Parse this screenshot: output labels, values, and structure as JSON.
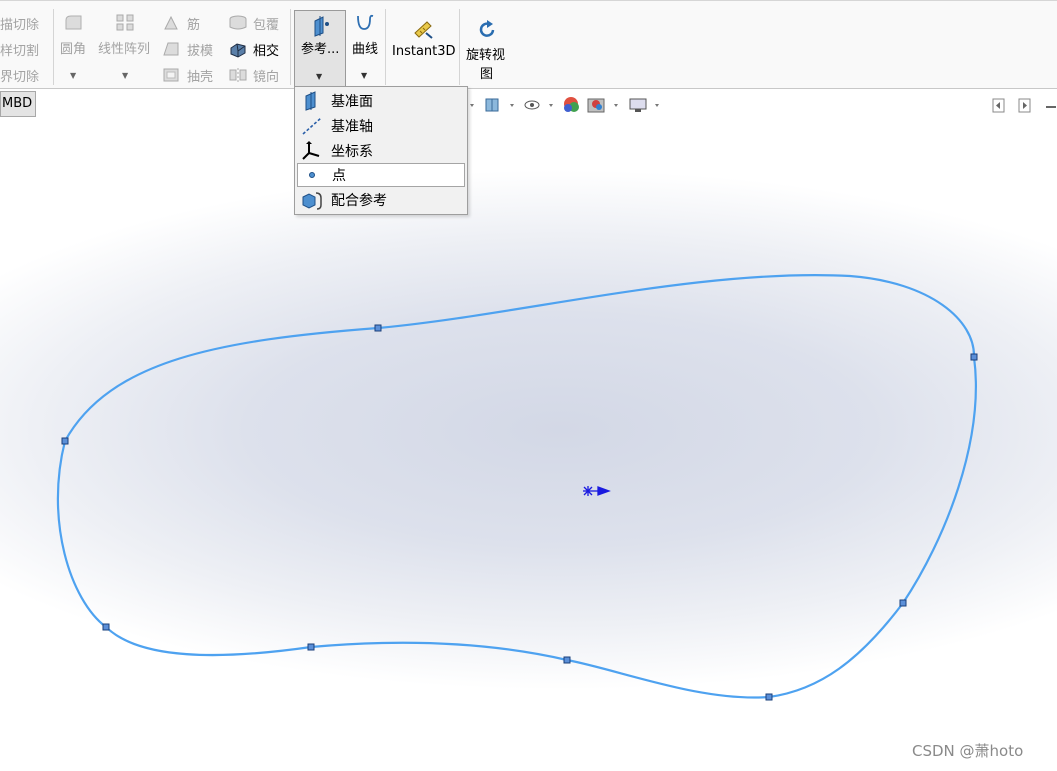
{
  "ribbon": {
    "col1": [
      "描切除",
      "样切割",
      "界切除"
    ],
    "fillet": "圆角",
    "linear_pattern": "线性阵列",
    "rib": "筋",
    "draft": "拔模",
    "shell": "抽壳",
    "wrap": "包覆",
    "intersect": "相交",
    "mirror": "镜向",
    "reference": "参考...",
    "curves": "曲线",
    "instant3d": "Instant3D",
    "rotate_view_line1": "旋转视",
    "rotate_view_line2": "图"
  },
  "tab": {
    "label": "MBD"
  },
  "reference_menu": {
    "items": [
      {
        "label": "基准面",
        "icon": "plane-icon"
      },
      {
        "label": "基准轴",
        "icon": "axis-icon"
      },
      {
        "label": "坐标系",
        "icon": "coordinate-system-icon"
      },
      {
        "label": "点",
        "icon": "point-icon",
        "highlighted": true
      },
      {
        "label": "配合参考",
        "icon": "mate-reference-icon"
      }
    ]
  },
  "watermark": "CSDN @萧hoto",
  "colors": {
    "curve": "#4ea2f0",
    "origin": "#1a1ae0",
    "ribbon_bg": "#f9f9f9"
  }
}
